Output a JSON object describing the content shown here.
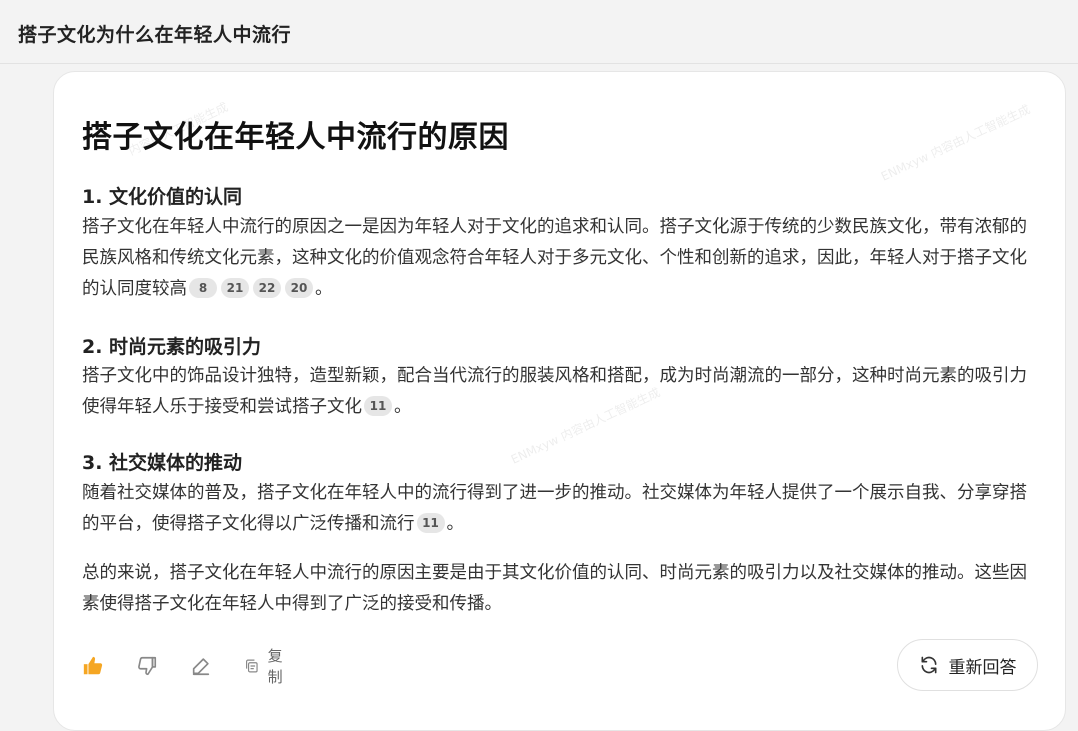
{
  "header": {
    "title": "搭子文化为什么在年轻人中流行"
  },
  "answer": {
    "heading": "搭子文化在年轻人中流行的原因",
    "sections": [
      {
        "title": "1. 文化价值的认同",
        "text": "搭子文化在年轻人中流行的原因之一是因为年轻人对于文化的追求和认同。搭子文化源于传统的少数民族文化，带有浓郁的民族风格和传统文化元素，这种文化的价值观念符合年轻人对于多元文化、个性和创新的追求，因此，年轻人对于搭子文化的认同度较高",
        "citations": [
          "8",
          "21",
          "22",
          "20"
        ]
      },
      {
        "title": "2. 时尚元素的吸引力",
        "text": "搭子文化中的饰品设计独特，造型新颖，配合当代流行的服装风格和搭配，成为时尚潮流的一部分，这种时尚元素的吸引力使得年轻人乐于接受和尝试搭子文化",
        "citations": [
          "11"
        ]
      },
      {
        "title": "3. 社交媒体的推动",
        "text": "随着社交媒体的普及，搭子文化在年轻人中的流行得到了进一步的推动。社交媒体为年轻人提供了一个展示自我、分享穿搭的平台，使得搭子文化得以广泛传播和流行",
        "citations": [
          "11"
        ]
      }
    ],
    "summary": "总的来说，搭子文化在年轻人中流行的原因主要是由于其文化价值的认同、时尚元素的吸引力以及社交媒体的推动。这些因素使得搭子文化在年轻人中得到了广泛的接受和传播。",
    "period": "。"
  },
  "actions": {
    "copy_label": "复制",
    "regenerate_label": "重新回答"
  },
  "watermark": {
    "line1": "ENMxyw",
    "line2": "内容由人工智能生成"
  },
  "colors": {
    "like_active": "#f5a623",
    "icon_gray": "#888888",
    "background": "#f3f3f3"
  }
}
